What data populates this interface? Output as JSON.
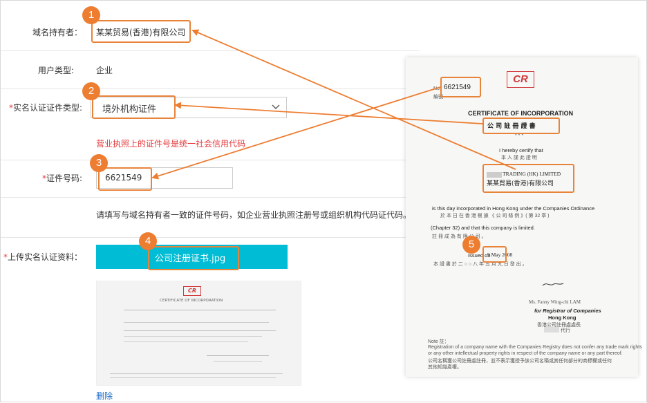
{
  "form": {
    "holder_label": "域名持有者：",
    "holder_value": "某某贸易(香港)有限公司",
    "user_type_label": "用户类型:",
    "user_type_value": "企业",
    "cert_type_label_req": "*",
    "cert_type_label": "实名认证证件类型:",
    "cert_type_value": "境外机构证件",
    "cert_type_hint": "营业执照上的证件号是统一社会信用代码",
    "cert_no_label_req": "*",
    "cert_no_label": "证件号码:",
    "cert_no_value": "6621549",
    "cert_no_hint": "请填写与域名持有者一致的证件号码，如企业营业执照注册号或组织机构代码证代码。",
    "upload_label_req": "*",
    "upload_label": "上传实名认证资料：",
    "upload_file": "公司注册证书.jpg",
    "delete_label": "删除"
  },
  "badges": [
    "1",
    "2",
    "3",
    "4",
    "5"
  ],
  "thumb": {
    "logo": "CR",
    "title": "CERTIFICATE OF INCORPORATION"
  },
  "certificate": {
    "logo": "CR",
    "no_prefix": "No.",
    "no_cn": "編號",
    "number": "6621549",
    "title_en": "CERTIFICATE OF INCORPORATION",
    "title_cn": "公 司 註 冊 證 書",
    "stars": "* * *",
    "certify_en": "I hereby certify that",
    "certify_cn": "本 人 謹 此 證 明",
    "company_en": "TRADING (HK) LIMITED",
    "company_cn": "某某貿易(香港)有限公司",
    "line1_en": "is this day incorporated in Hong Kong under the Companies Ordinance",
    "line1_cn": "於 本 日 在 香 港 根 據 《 公 司 條 例 》( 第 32 章 )",
    "line2_en": "(Chapter 32) and that this company is limited.",
    "line2_cn": "註 冊 成 為 有 限 公 司 。",
    "issued_label": "Issued on",
    "issued_date": "9 May 2008",
    "issued_cn": "本 證 書 於 二 ○ ○ 八 年 五 月 九 日 發 出 。",
    "signer": "Ms. Fanny Wing-chi LAM",
    "registrar_en": "for Registrar of Companies",
    "registrar_place": "Hong Kong",
    "registrar_cn": "香港公司註冊處處長",
    "registrar_cn2": "代行",
    "note_label": "Note 註：",
    "note_en1": "Registration of a company name with the Companies Registry does not confer any trade mark rights",
    "note_en2": "or any other intellectual property rights in respect of the company name or any part thereof.",
    "note_cn1": "公司名稱獲公司註冊處註冊，並不表示獲授予該公司名稱或其任何部分的商標權或任何",
    "note_cn2": "其他知識產權。"
  },
  "colors": {
    "accent_orange": "#ed7d31",
    "upload_cyan": "#00bcd4",
    "required_red": "#e4393c",
    "link_blue": "#1e6ec8",
    "cr_red": "#d0393c"
  }
}
